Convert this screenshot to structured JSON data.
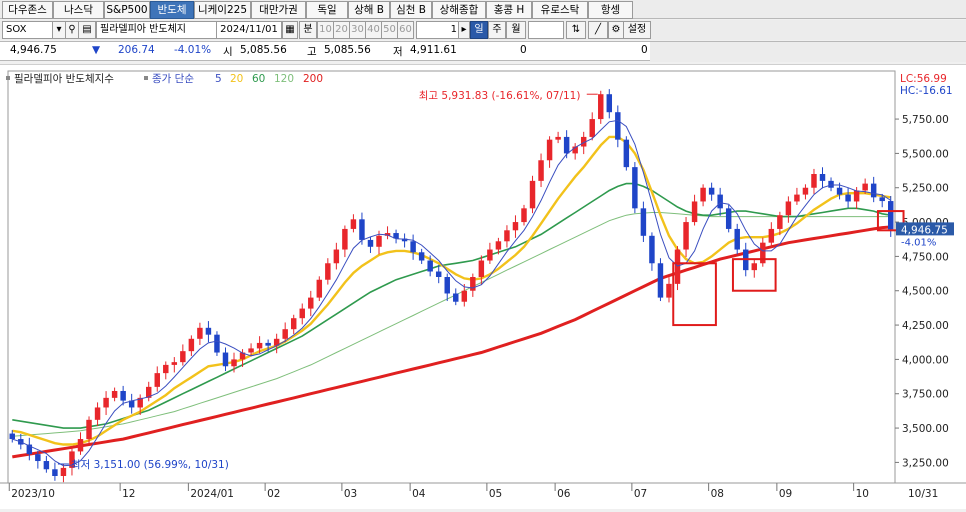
{
  "tabs": [
    "다우존스",
    "나스닥",
    "S&P500",
    "반도체",
    "니케이225",
    "대만가권",
    "독일",
    "상해 B",
    "심천 B",
    "상해종합",
    "홍콩 H",
    "유로스탁",
    "항셍"
  ],
  "active_tab": "반도체",
  "toolbar": {
    "symbol": "SOX",
    "name": "필라델피아 반도체지",
    "date": "2024/11/01",
    "period_labels": [
      "분",
      "10",
      "20",
      "30",
      "40",
      "50",
      "60"
    ],
    "count": "1",
    "day": "일",
    "week": "주",
    "month": "월",
    "settings": "설정"
  },
  "price": {
    "last": "4,946.75",
    "arrow": "▼",
    "change": "206.74",
    "pct": "-4.01%",
    "open_label": "시",
    "open": "5,085.56",
    "high_label": "고",
    "high": "5,085.56",
    "low_label": "저",
    "low": "4,911.61",
    "volume": "0",
    "right_value": "0"
  },
  "colors": {
    "up": "#e8262b",
    "down": "#1f45c8",
    "ma5": "#3a4ec0",
    "ma20": "#f2c21b",
    "ma60": "#2f9a4e",
    "ma120": "#7fbf7b",
    "ma200": "#e02020",
    "highlight": "#e01b1b"
  },
  "chart_data": {
    "type": "candlestick",
    "title": "필라델피아 반도체지수",
    "price_type": "종가 단순",
    "ma_periods": [
      "5",
      "20",
      "60",
      "120",
      "200"
    ],
    "x_ticks": [
      "2023/10",
      "12",
      "2024/01",
      "02",
      "03",
      "04",
      "05",
      "06",
      "07",
      "08",
      "09",
      "10",
      "10/31"
    ],
    "ylim": [
      3100,
      6100
    ],
    "y_ticks": [
      3250,
      3500,
      3750,
      4000,
      4250,
      4500,
      4750,
      5000,
      5250,
      5500,
      5750
    ],
    "y_tick_labels": [
      "3,250.00",
      "3,500.00",
      "3,750.00",
      "4,000.00",
      "4,250.00",
      "4,500.00",
      "4,750.00",
      "5,000.00",
      "5,250.00",
      "5,500.00",
      "5,750.00"
    ],
    "top_right_labels": [
      "LC:56.99",
      "HC:-16.61"
    ],
    "last_price_label": "4,946.75",
    "last_pct_label": "-4.01%",
    "max_annotation": "최고 5,931.83 (-16.61%, 07/11)",
    "min_annotation": "최저 3,151.00 (56.99%, 10/31)",
    "closes": [
      3420,
      3380,
      3310,
      3260,
      3200,
      3151,
      3210,
      3330,
      3420,
      3560,
      3650,
      3720,
      3770,
      3700,
      3650,
      3720,
      3800,
      3900,
      3960,
      3980,
      4060,
      4150,
      4230,
      4180,
      4050,
      3950,
      4000,
      4050,
      4080,
      4120,
      4100,
      4150,
      4220,
      4300,
      4370,
      4450,
      4580,
      4700,
      4800,
      4950,
      5020,
      4870,
      4820,
      4900,
      4920,
      4880,
      4860,
      4780,
      4720,
      4640,
      4600,
      4480,
      4420,
      4500,
      4600,
      4720,
      4800,
      4860,
      4940,
      5000,
      5100,
      5300,
      5450,
      5600,
      5620,
      5500,
      5550,
      5620,
      5750,
      5931,
      5800,
      5600,
      5400,
      5100,
      4900,
      4700,
      4450,
      4550,
      4800,
      5000,
      5150,
      5250,
      5200,
      5100,
      4950,
      4800,
      4650,
      4700,
      4850,
      4950,
      5050,
      5150,
      5200,
      5250,
      5350,
      5300,
      5250,
      5200,
      5150,
      5230,
      5280,
      5180,
      5153,
      4946.75
    ],
    "ma20": [
      3480,
      3470,
      3450,
      3430,
      3410,
      3390,
      3380,
      3380,
      3390,
      3410,
      3440,
      3480,
      3520,
      3560,
      3590,
      3620,
      3660,
      3700,
      3740,
      3790,
      3830,
      3870,
      3910,
      3950,
      3960,
      3970,
      3980,
      4000,
      4030,
      4060,
      4080,
      4100,
      4130,
      4170,
      4210,
      4260,
      4330,
      4400,
      4480,
      4560,
      4630,
      4680,
      4720,
      4760,
      4780,
      4790,
      4790,
      4780,
      4760,
      4730,
      4700,
      4660,
      4620,
      4590,
      4580,
      4590,
      4620,
      4660,
      4710,
      4760,
      4820,
      4900,
      4990,
      5080,
      5170,
      5250,
      5330,
      5400,
      5480,
      5560,
      5620,
      5620,
      5580,
      5500,
      5380,
      5220,
      5050,
      4900,
      4800,
      4730,
      4700,
      4710,
      4750,
      4800,
      4850,
      4880,
      4890,
      4890,
      4890,
      4900,
      4920,
      4950,
      4990,
      5040,
      5090,
      5130,
      5170,
      5200,
      5210,
      5210,
      5210,
      5200,
      5190,
      5180
    ],
    "ma60": [
      3560,
      3550,
      3540,
      3530,
      3520,
      3510,
      3500,
      3500,
      3500,
      3510,
      3520,
      3530,
      3550,
      3570,
      3590,
      3610,
      3630,
      3660,
      3690,
      3720,
      3750,
      3780,
      3810,
      3840,
      3870,
      3900,
      3930,
      3960,
      3990,
      4020,
      4050,
      4080,
      4110,
      4140,
      4170,
      4210,
      4250,
      4290,
      4330,
      4370,
      4410,
      4450,
      4490,
      4520,
      4550,
      4580,
      4600,
      4620,
      4640,
      4660,
      4680,
      4690,
      4700,
      4710,
      4720,
      4740,
      4760,
      4780,
      4800,
      4820,
      4850,
      4880,
      4910,
      4950,
      4990,
      5030,
      5070,
      5110,
      5150,
      5190,
      5230,
      5260,
      5280,
      5280,
      5260,
      5230,
      5190,
      5150,
      5110,
      5080,
      5060,
      5050,
      5050,
      5060,
      5070,
      5080,
      5080,
      5070,
      5060,
      5050,
      5040,
      5040,
      5040,
      5050,
      5060,
      5070,
      5080,
      5090,
      5100,
      5100,
      5090,
      5080,
      5060,
      5050
    ],
    "ma120": [
      3440,
      3445,
      3450,
      3455,
      3460,
      3465,
      3470,
      3475,
      3480,
      3490,
      3500,
      3510,
      3520,
      3530,
      3545,
      3560,
      3575,
      3590,
      3605,
      3620,
      3640,
      3660,
      3680,
      3700,
      3720,
      3740,
      3760,
      3780,
      3800,
      3820,
      3840,
      3860,
      3885,
      3910,
      3935,
      3960,
      3990,
      4020,
      4050,
      4080,
      4110,
      4140,
      4170,
      4200,
      4230,
      4260,
      4290,
      4320,
      4350,
      4380,
      4410,
      4440,
      4470,
      4500,
      4530,
      4560,
      4590,
      4620,
      4650,
      4680,
      4710,
      4740,
      4770,
      4800,
      4830,
      4860,
      4890,
      4920,
      4950,
      4980,
      5010,
      5030,
      5050,
      5060,
      5065,
      5070,
      5070,
      5065,
      5060,
      5055,
      5050,
      5045,
      5040,
      5040,
      5040,
      5040,
      5040,
      5040,
      5040,
      5040,
      5040,
      5040,
      5040,
      5040,
      5040,
      5040,
      5040,
      5040,
      5040,
      5040,
      5040,
      5040,
      5040,
      5040
    ],
    "ma200": [
      3290,
      3300,
      3310,
      3320,
      3330,
      3340,
      3350,
      3360,
      3370,
      3380,
      3390,
      3400,
      3410,
      3420,
      3435,
      3450,
      3465,
      3480,
      3495,
      3510,
      3525,
      3540,
      3555,
      3570,
      3585,
      3600,
      3615,
      3630,
      3645,
      3660,
      3675,
      3690,
      3705,
      3720,
      3735,
      3750,
      3765,
      3780,
      3795,
      3810,
      3825,
      3840,
      3855,
      3870,
      3885,
      3900,
      3915,
      3930,
      3945,
      3960,
      3975,
      3990,
      4005,
      4020,
      4035,
      4050,
      4070,
      4090,
      4110,
      4130,
      4150,
      4170,
      4190,
      4215,
      4240,
      4265,
      4290,
      4320,
      4350,
      4380,
      4410,
      4440,
      4470,
      4500,
      4530,
      4560,
      4590,
      4610,
      4630,
      4650,
      4670,
      4690,
      4710,
      4730,
      4745,
      4760,
      4775,
      4790,
      4805,
      4820,
      4835,
      4850,
      4860,
      4870,
      4880,
      4890,
      4900,
      4910,
      4920,
      4930,
      4940,
      4950,
      4960,
      4965
    ],
    "highlight_boxes": [
      {
        "x0": 78,
        "x1": 82,
        "y0": 4250,
        "y1": 4700
      },
      {
        "x0": 85,
        "x1": 89,
        "y0": 4500,
        "y1": 4730
      },
      {
        "x0": 102,
        "x1": 104,
        "y0": 4940,
        "y1": 5080
      }
    ]
  }
}
